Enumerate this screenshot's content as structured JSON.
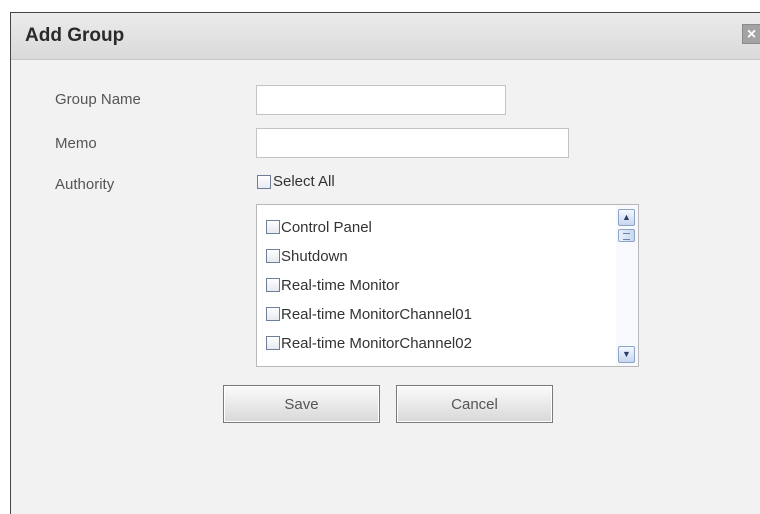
{
  "dialog": {
    "title": "Add Group",
    "close_label": "×"
  },
  "form": {
    "group_name_label": "Group Name",
    "group_name_value": "",
    "memo_label": "Memo",
    "memo_value": "",
    "authority_label": "Authority",
    "select_all_label": "Select All"
  },
  "authority_list": {
    "items": [
      {
        "label": "Control Panel",
        "checked": false
      },
      {
        "label": "Shutdown",
        "checked": false
      },
      {
        "label": "Real-time Monitor",
        "checked": false
      },
      {
        "label": "Real-time MonitorChannel01",
        "checked": false
      },
      {
        "label": "Real-time MonitorChannel02",
        "checked": false
      }
    ],
    "scroll_up_icon": "▲",
    "scroll_down_icon": "▼"
  },
  "buttons": {
    "save_label": "Save",
    "cancel_label": "Cancel"
  }
}
